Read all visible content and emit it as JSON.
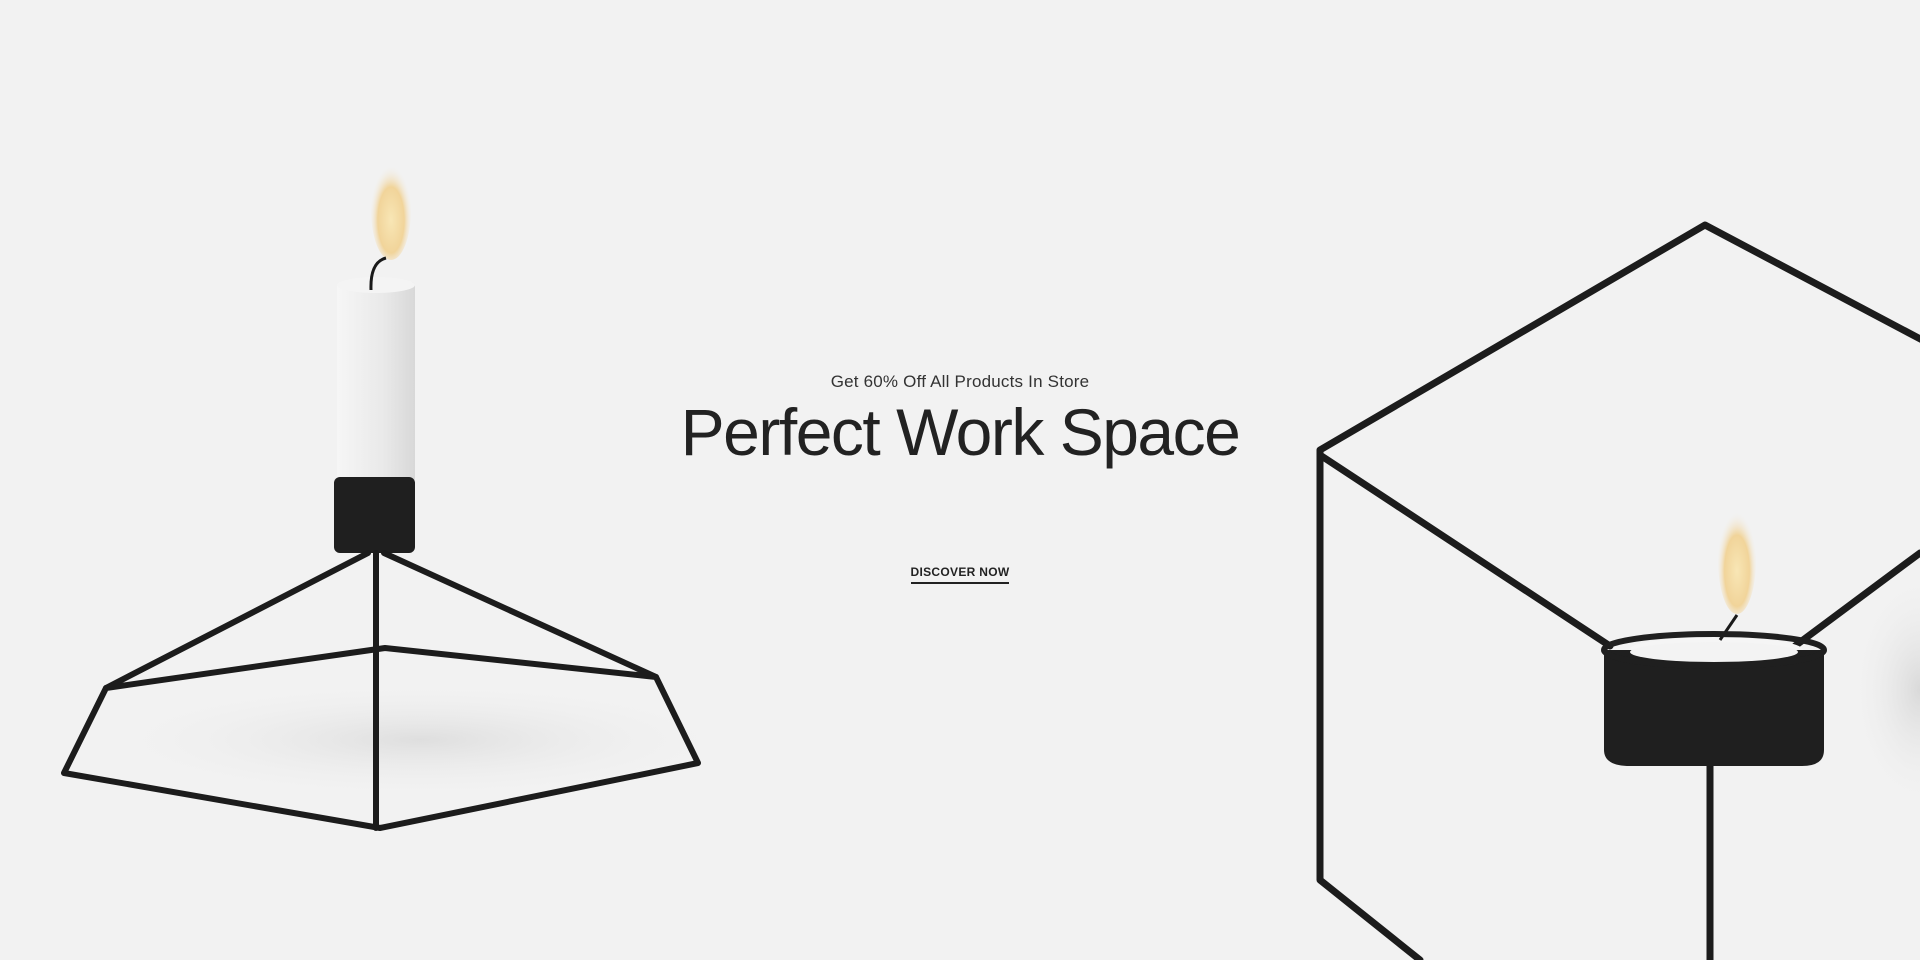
{
  "hero": {
    "subtitle": "Get 60% Off All Products In Store",
    "title": "Perfect Work Space",
    "cta_label": "DISCOVER NOW"
  },
  "images": {
    "left": "pentagon-candle-holder-image",
    "right": "cube-tealight-holder-image"
  },
  "colors": {
    "background": "#f2f2f2",
    "text": "#222222",
    "metal": "#1c1c1c",
    "candle": "#ececec",
    "flame": "#f4d9a0"
  }
}
